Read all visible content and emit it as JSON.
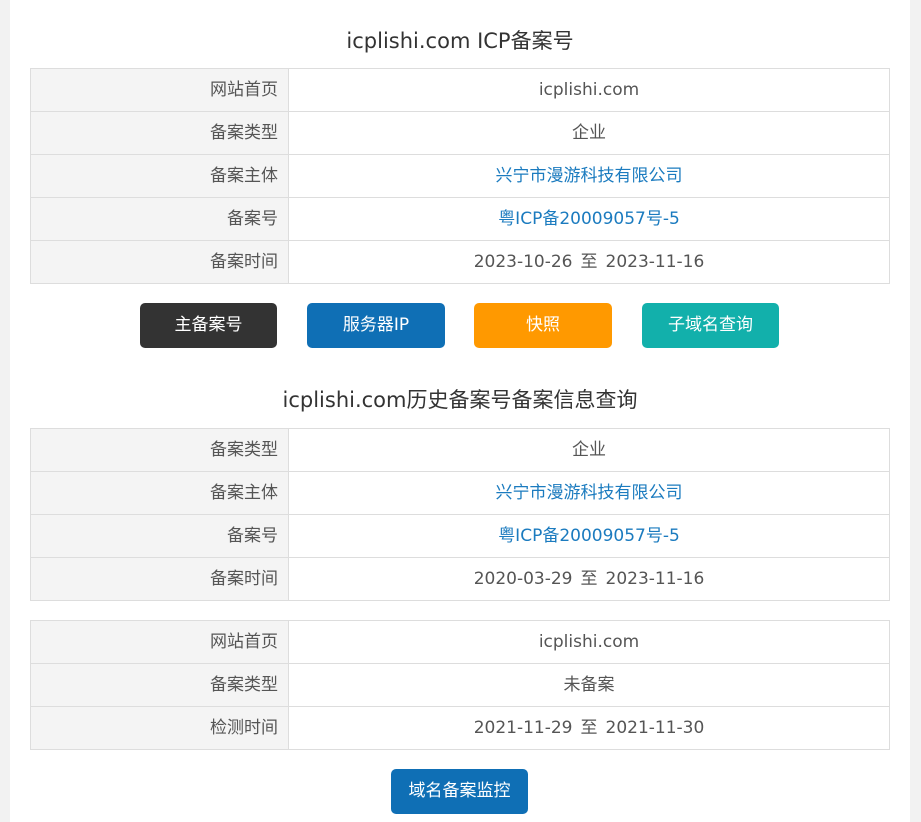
{
  "section1": {
    "title": "icplishi.com ICP备案号",
    "rows": [
      {
        "label": "网站首页",
        "value": "icplishi.com"
      },
      {
        "label": "备案类型",
        "value": "企业"
      },
      {
        "label": "备案主体",
        "value": "兴宁市漫游科技有限公司"
      },
      {
        "label": "备案号",
        "value": "粤ICP备20009057号-5"
      },
      {
        "label": "备案时间",
        "from": "2023-10-26",
        "sep": "至",
        "to": "2023-11-16"
      }
    ]
  },
  "buttons": [
    {
      "label": "主备案号",
      "color": "#333333"
    },
    {
      "label": "服务器IP",
      "color": "#0f6fb5"
    },
    {
      "label": "快照",
      "color": "#ff9900"
    },
    {
      "label": "子域名查询",
      "color": "#12b0ab"
    }
  ],
  "section2": {
    "title": "icplishi.com历史备案号备案信息查询",
    "record1": [
      {
        "label": "备案类型",
        "value": "企业"
      },
      {
        "label": "备案主体",
        "value": "兴宁市漫游科技有限公司"
      },
      {
        "label": "备案号",
        "value": "粤ICP备20009057号-5"
      },
      {
        "label": "备案时间",
        "from": "2020-03-29",
        "sep": "至",
        "to": "2023-11-16"
      }
    ],
    "record2": [
      {
        "label": "网站首页",
        "value": "icplishi.com"
      },
      {
        "label": "备案类型",
        "value": "未备案"
      },
      {
        "label": "检测时间",
        "from": "2021-11-29",
        "sep": "至",
        "to": "2021-11-30"
      }
    ]
  },
  "monitor_button": {
    "label": "域名备案监控",
    "color": "#0f6fb5"
  }
}
